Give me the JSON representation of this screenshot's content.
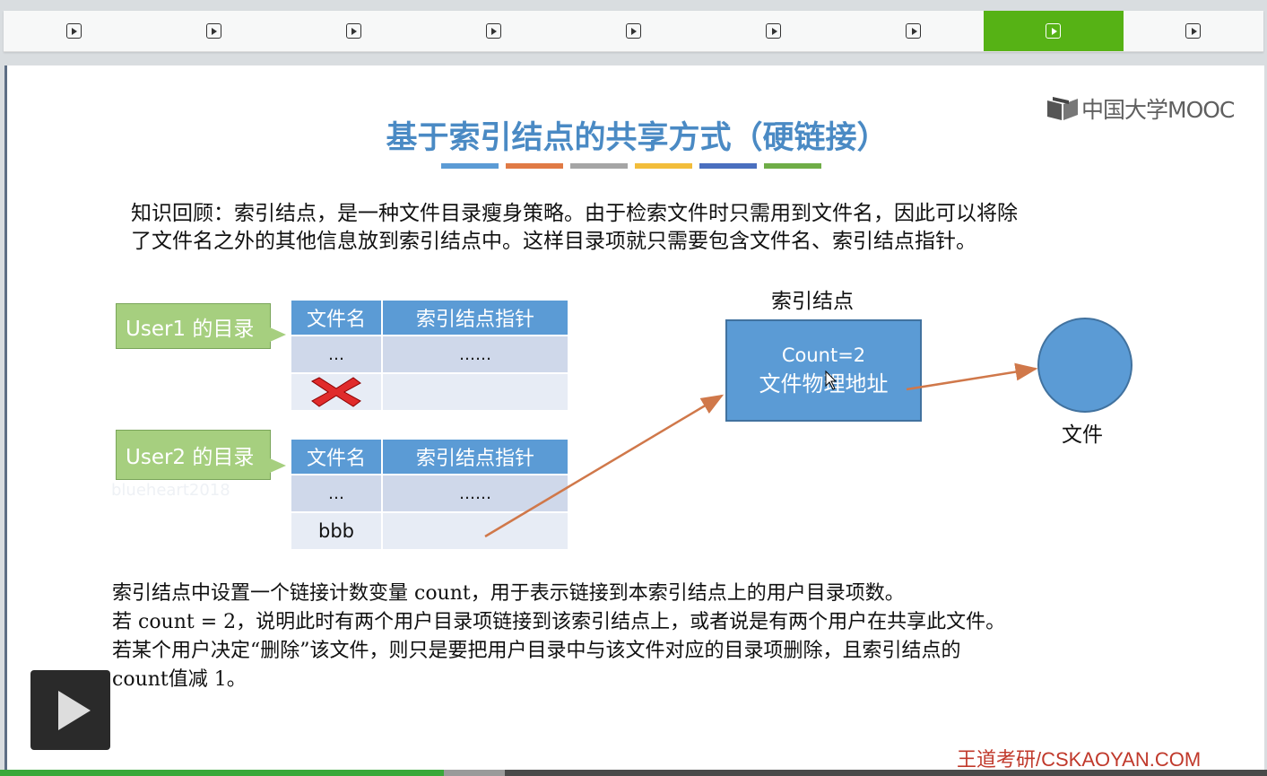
{
  "tabs": [
    {
      "icon": "play-icon",
      "active": false
    },
    {
      "icon": "play-icon",
      "active": false
    },
    {
      "icon": "play-icon",
      "active": false
    },
    {
      "icon": "play-icon",
      "active": false
    },
    {
      "icon": "play-icon",
      "active": false
    },
    {
      "icon": "play-icon",
      "active": false
    },
    {
      "icon": "play-icon",
      "active": false
    },
    {
      "icon": "play-icon",
      "active": true
    },
    {
      "icon": "play-icon",
      "active": false
    }
  ],
  "colors": {
    "active_tab": "#56b215",
    "title": "#4a8ac4",
    "accent_blue": "#5b9bd5",
    "callout_green": "#a6cf7f",
    "arrow": "#d0784a",
    "brand_red": "#c0392b",
    "title_bars": [
      "#5b9bd5",
      "#e07a45",
      "#a5a5a5",
      "#f2bd3b",
      "#4a6fbf",
      "#6fad47"
    ]
  },
  "slide": {
    "logo_text": "中国大学MOOC",
    "title": "基于索引结点的共享方式（硬链接）",
    "review_line1": "知识回顾：索引结点，是一种文件目录瘦身策略。由于检索文件时只需用到文件名，因此可以将除",
    "review_line2": "了文件名之外的其他信息放到索引结点中。这样目录项就只需要包含文件名、索引结点指针。",
    "user1_label": "User1 的目录",
    "user2_label": "User2 的目录",
    "table1": {
      "headers": [
        "文件名",
        "索引结点指针"
      ],
      "rows": [
        [
          "…",
          "……"
        ],
        [
          "",
          ""
        ]
      ]
    },
    "table2": {
      "headers": [
        "文件名",
        "索引结点指针"
      ],
      "rows": [
        [
          "…",
          "……"
        ],
        [
          "bbb",
          ""
        ]
      ]
    },
    "inode_label": "索引结点",
    "inode_count": "Count=2",
    "inode_addr": "文件物理地址",
    "file_label": "文件",
    "watermark": "blueheart2018",
    "body_line1": "索引结点中设置一个链接计数变量 count，用于表示链接到本索引结点上的用户目录项数。",
    "body_line2": "若 count = 2，说明此时有两个用户目录项链接到该索引结点上，或者说是有两个用户在共享此文件。",
    "body_line3": "若某个用户决定“删除”该文件，则只是要把用户目录中与该文件对应的目录项删除，且索引结点的",
    "body_line4": "count值减 1。",
    "footer_brand": "王道考研/CSKAOYAN.COM"
  },
  "player": {
    "progress_fraction": 0.35
  }
}
